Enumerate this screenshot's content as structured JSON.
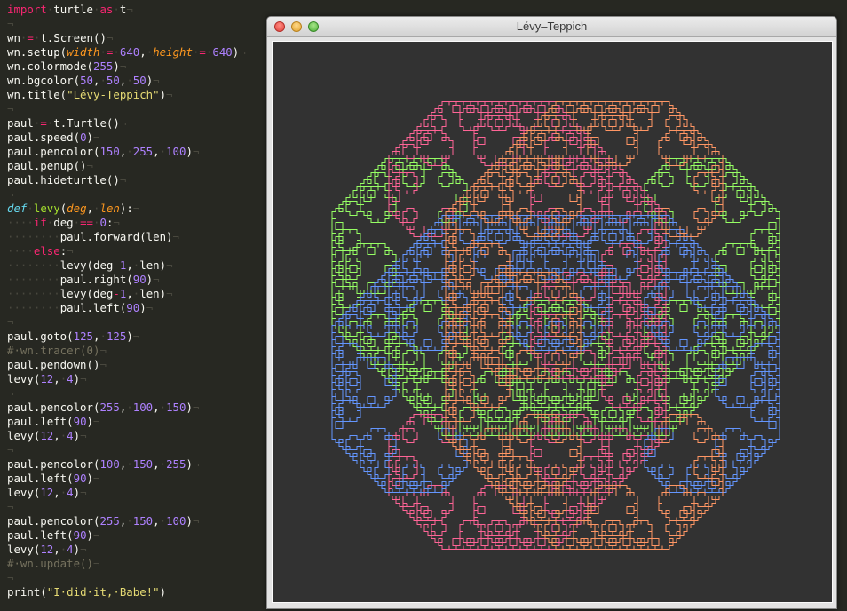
{
  "editor": {
    "lines": [
      [
        [
          "kw",
          "import"
        ],
        [
          "ws",
          "·"
        ],
        [
          "plain",
          "turtle"
        ],
        [
          "ws",
          "·"
        ],
        [
          "kw",
          "as"
        ],
        [
          "ws",
          "·"
        ],
        [
          "plain",
          "t"
        ],
        [
          "ws",
          "¬"
        ]
      ],
      [
        [
          "ws",
          "¬"
        ]
      ],
      [
        [
          "plain",
          "wn"
        ],
        [
          "ws",
          "·"
        ],
        [
          "op",
          "="
        ],
        [
          "ws",
          "·"
        ],
        [
          "plain",
          "t.Screen()"
        ],
        [
          "ws",
          "¬"
        ]
      ],
      [
        [
          "plain",
          "wn.setup("
        ],
        [
          "param",
          "width"
        ],
        [
          "ws",
          "·"
        ],
        [
          "op",
          "="
        ],
        [
          "ws",
          "·"
        ],
        [
          "num",
          "640"
        ],
        [
          "plain",
          ","
        ],
        [
          "ws",
          "·"
        ],
        [
          "param",
          "height"
        ],
        [
          "ws",
          "·"
        ],
        [
          "op",
          "="
        ],
        [
          "ws",
          "·"
        ],
        [
          "num",
          "640"
        ],
        [
          "plain",
          ")"
        ],
        [
          "ws",
          "¬"
        ]
      ],
      [
        [
          "plain",
          "wn.colormode("
        ],
        [
          "num",
          "255"
        ],
        [
          "plain",
          ")"
        ],
        [
          "ws",
          "¬"
        ]
      ],
      [
        [
          "plain",
          "wn.bgcolor("
        ],
        [
          "num",
          "50"
        ],
        [
          "plain",
          ","
        ],
        [
          "ws",
          "·"
        ],
        [
          "num",
          "50"
        ],
        [
          "plain",
          ","
        ],
        [
          "ws",
          "·"
        ],
        [
          "num",
          "50"
        ],
        [
          "plain",
          ")"
        ],
        [
          "ws",
          "¬"
        ]
      ],
      [
        [
          "plain",
          "wn.title("
        ],
        [
          "str",
          "\"Lévy-Teppich\""
        ],
        [
          "plain",
          ")"
        ],
        [
          "ws",
          "¬"
        ]
      ],
      [
        [
          "ws",
          "¬"
        ]
      ],
      [
        [
          "plain",
          "paul"
        ],
        [
          "ws",
          "·"
        ],
        [
          "op",
          "="
        ],
        [
          "ws",
          "·"
        ],
        [
          "plain",
          "t.Turtle()"
        ],
        [
          "ws",
          "¬"
        ]
      ],
      [
        [
          "plain",
          "paul.speed("
        ],
        [
          "num",
          "0"
        ],
        [
          "plain",
          ")"
        ],
        [
          "ws",
          "¬"
        ]
      ],
      [
        [
          "plain",
          "paul.pencolor("
        ],
        [
          "num",
          "150"
        ],
        [
          "plain",
          ","
        ],
        [
          "ws",
          "·"
        ],
        [
          "num",
          "255"
        ],
        [
          "plain",
          ","
        ],
        [
          "ws",
          "·"
        ],
        [
          "num",
          "100"
        ],
        [
          "plain",
          ")"
        ],
        [
          "ws",
          "¬"
        ]
      ],
      [
        [
          "plain",
          "paul.penup()"
        ],
        [
          "ws",
          "¬"
        ]
      ],
      [
        [
          "plain",
          "paul.hideturtle()"
        ],
        [
          "ws",
          "¬"
        ]
      ],
      [
        [
          "ws",
          "¬"
        ]
      ],
      [
        [
          "def",
          "def"
        ],
        [
          "ws",
          "·"
        ],
        [
          "fn",
          "levy"
        ],
        [
          "plain",
          "("
        ],
        [
          "param",
          "deg"
        ],
        [
          "plain",
          ","
        ],
        [
          "ws",
          "·"
        ],
        [
          "param",
          "len"
        ],
        [
          "plain",
          "):"
        ],
        [
          "ws",
          "¬"
        ]
      ],
      [
        [
          "ws",
          "····"
        ],
        [
          "kw",
          "if"
        ],
        [
          "ws",
          "·"
        ],
        [
          "plain",
          "deg"
        ],
        [
          "ws",
          "·"
        ],
        [
          "op",
          "=="
        ],
        [
          "ws",
          "·"
        ],
        [
          "num",
          "0"
        ],
        [
          "plain",
          ":"
        ],
        [
          "ws",
          "¬"
        ]
      ],
      [
        [
          "ws",
          "········"
        ],
        [
          "plain",
          "paul.forward(len)"
        ],
        [
          "ws",
          "¬"
        ]
      ],
      [
        [
          "ws",
          "····"
        ],
        [
          "kw",
          "else"
        ],
        [
          "plain",
          ":"
        ],
        [
          "ws",
          "¬"
        ]
      ],
      [
        [
          "ws",
          "········"
        ],
        [
          "plain",
          "levy(deg"
        ],
        [
          "op",
          "-"
        ],
        [
          "num",
          "1"
        ],
        [
          "plain",
          ","
        ],
        [
          "ws",
          "·"
        ],
        [
          "plain",
          "len)"
        ],
        [
          "ws",
          "¬"
        ]
      ],
      [
        [
          "ws",
          "········"
        ],
        [
          "plain",
          "paul.right("
        ],
        [
          "num",
          "90"
        ],
        [
          "plain",
          ")"
        ],
        [
          "ws",
          "¬"
        ]
      ],
      [
        [
          "ws",
          "········"
        ],
        [
          "plain",
          "levy(deg"
        ],
        [
          "op",
          "-"
        ],
        [
          "num",
          "1"
        ],
        [
          "plain",
          ","
        ],
        [
          "ws",
          "·"
        ],
        [
          "plain",
          "len)"
        ],
        [
          "ws",
          "¬"
        ]
      ],
      [
        [
          "ws",
          "········"
        ],
        [
          "plain",
          "paul.left("
        ],
        [
          "num",
          "90"
        ],
        [
          "plain",
          ")"
        ],
        [
          "ws",
          "¬"
        ]
      ],
      [
        [
          "ws",
          "¬"
        ]
      ],
      [
        [
          "plain",
          "paul.goto("
        ],
        [
          "num",
          "125"
        ],
        [
          "plain",
          ","
        ],
        [
          "ws",
          "·"
        ],
        [
          "num",
          "125"
        ],
        [
          "plain",
          ")"
        ],
        [
          "ws",
          "¬"
        ]
      ],
      [
        [
          "comment",
          "#·wn.tracer(0)"
        ],
        [
          "ws",
          "¬"
        ]
      ],
      [
        [
          "plain",
          "paul.pendown()"
        ],
        [
          "ws",
          "¬"
        ]
      ],
      [
        [
          "plain",
          "levy("
        ],
        [
          "num",
          "12"
        ],
        [
          "plain",
          ","
        ],
        [
          "ws",
          "·"
        ],
        [
          "num",
          "4"
        ],
        [
          "plain",
          ")"
        ],
        [
          "ws",
          "¬"
        ]
      ],
      [
        [
          "ws",
          "¬"
        ]
      ],
      [
        [
          "plain",
          "paul.pencolor("
        ],
        [
          "num",
          "255"
        ],
        [
          "plain",
          ","
        ],
        [
          "ws",
          "·"
        ],
        [
          "num",
          "100"
        ],
        [
          "plain",
          ","
        ],
        [
          "ws",
          "·"
        ],
        [
          "num",
          "150"
        ],
        [
          "plain",
          ")"
        ],
        [
          "ws",
          "¬"
        ]
      ],
      [
        [
          "plain",
          "paul.left("
        ],
        [
          "num",
          "90"
        ],
        [
          "plain",
          ")"
        ],
        [
          "ws",
          "¬"
        ]
      ],
      [
        [
          "plain",
          "levy("
        ],
        [
          "num",
          "12"
        ],
        [
          "plain",
          ","
        ],
        [
          "ws",
          "·"
        ],
        [
          "num",
          "4"
        ],
        [
          "plain",
          ")"
        ],
        [
          "ws",
          "¬"
        ]
      ],
      [
        [
          "ws",
          "¬"
        ]
      ],
      [
        [
          "plain",
          "paul.pencolor("
        ],
        [
          "num",
          "100"
        ],
        [
          "plain",
          ","
        ],
        [
          "ws",
          "·"
        ],
        [
          "num",
          "150"
        ],
        [
          "plain",
          ","
        ],
        [
          "ws",
          "·"
        ],
        [
          "num",
          "255"
        ],
        [
          "plain",
          ")"
        ],
        [
          "ws",
          "¬"
        ]
      ],
      [
        [
          "plain",
          "paul.left("
        ],
        [
          "num",
          "90"
        ],
        [
          "plain",
          ")"
        ],
        [
          "ws",
          "¬"
        ]
      ],
      [
        [
          "plain",
          "levy("
        ],
        [
          "num",
          "12"
        ],
        [
          "plain",
          ","
        ],
        [
          "ws",
          "·"
        ],
        [
          "num",
          "4"
        ],
        [
          "plain",
          ")"
        ],
        [
          "ws",
          "¬"
        ]
      ],
      [
        [
          "ws",
          "¬"
        ]
      ],
      [
        [
          "plain",
          "paul.pencolor("
        ],
        [
          "num",
          "255"
        ],
        [
          "plain",
          ","
        ],
        [
          "ws",
          "·"
        ],
        [
          "num",
          "150"
        ],
        [
          "plain",
          ","
        ],
        [
          "ws",
          "·"
        ],
        [
          "num",
          "100"
        ],
        [
          "plain",
          ")"
        ],
        [
          "ws",
          "¬"
        ]
      ],
      [
        [
          "plain",
          "paul.left("
        ],
        [
          "num",
          "90"
        ],
        [
          "plain",
          ")"
        ],
        [
          "ws",
          "¬"
        ]
      ],
      [
        [
          "plain",
          "levy("
        ],
        [
          "num",
          "12"
        ],
        [
          "plain",
          ","
        ],
        [
          "ws",
          "·"
        ],
        [
          "num",
          "4"
        ],
        [
          "plain",
          ")"
        ],
        [
          "ws",
          "¬"
        ]
      ],
      [
        [
          "comment",
          "#·wn.update()"
        ],
        [
          "ws",
          "¬"
        ]
      ],
      [
        [
          "ws",
          "¬"
        ]
      ],
      [
        [
          "plain",
          "print("
        ],
        [
          "str",
          "\"I·did·it,·Babe!\""
        ],
        [
          "plain",
          ")"
        ]
      ]
    ]
  },
  "window": {
    "title": "Lévy–Teppich",
    "close_icon": "close-icon",
    "minimize_icon": "minimize-icon",
    "zoom_icon": "zoom-icon"
  },
  "turtle": {
    "background": "#323232",
    "recursion_depth": 12,
    "segment_length": 4,
    "start": [
      125,
      125
    ],
    "curves": [
      {
        "color": "#96ff64",
        "turn_before": 0
      },
      {
        "color": "#ff6496",
        "turn_before": 90
      },
      {
        "color": "#6496ff",
        "turn_before": 90
      },
      {
        "color": "#ff9664",
        "turn_before": 90
      }
    ]
  }
}
